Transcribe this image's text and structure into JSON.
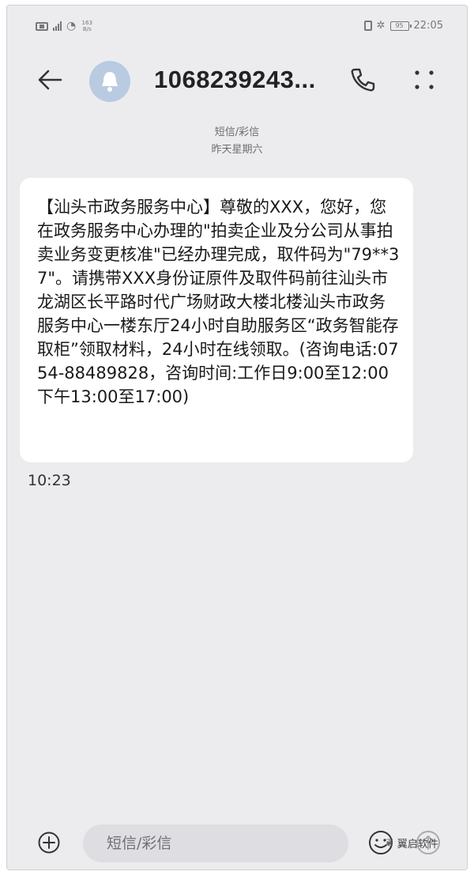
{
  "status_bar": {
    "net_speed": "163\nB/s",
    "battery": "95",
    "time": "22:05"
  },
  "header": {
    "contact": "1068239243..."
  },
  "thread": {
    "type_label": "短信/彩信",
    "date_label": "昨天星期六"
  },
  "message": {
    "body": "【汕头市政务服务中心】尊敬的XXX，您好，您在政务服务中心办理的\"拍卖企业及分公司从事拍卖业务变更核准\"已经办理完成，取件码为\"79**37\"。请携带XXX身份证原件及取件码前往汕头市龙湖区长平路时代广场财政大楼北楼汕头市政务服务中心一楼东厅24小时自助服务区“政务智能存取柜”领取材料，24小时在线领取。(咨询电话:0754-88489828，咨询时间:工作日9:00至12:00下午13:00至17:00)",
    "time": "10:23"
  },
  "input_bar": {
    "placeholder": "短信/彩信"
  },
  "watermark": {
    "text": "翼启软件"
  },
  "colors": {
    "background": "#ececef",
    "bubble": "#ffffff",
    "avatar": "#b9cbe0",
    "input": "#dedee2"
  }
}
